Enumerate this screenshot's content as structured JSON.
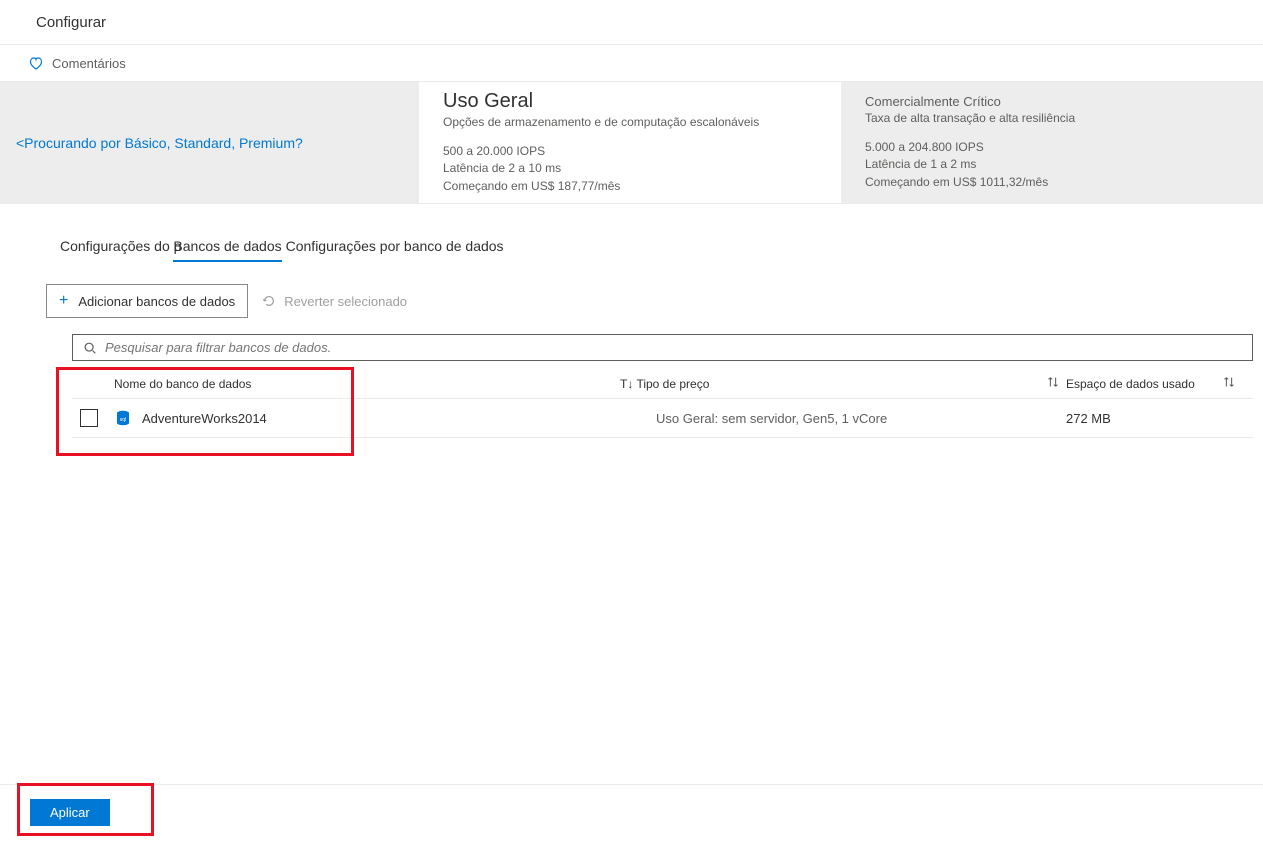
{
  "header": {
    "title": "Configurar"
  },
  "feedback": {
    "label": "Comentários"
  },
  "tiers": {
    "lookingForLink": "<Procurando por Básico, Standard, Premium?",
    "general": {
      "title": "Uso Geral",
      "subtitle": "Opções de armazenamento e de computação escalonáveis",
      "iops": "500 a 20.000 IOPS",
      "latency": "Latência de 2 a 10 ms",
      "price": "Começando em US$ 187,77/",
      "priceSuffix": "mês"
    },
    "critical": {
      "title": "Comercialmente Crítico",
      "subtitle": "Taxa de alta transação e alta resiliência",
      "iops": "5.000 a 204.800 IOPS",
      "latency": "Latência de 1 a 2 ms",
      "price": "Começando em US$ 1011,32/",
      "priceSuffix": "mês"
    }
  },
  "tabs": {
    "pool": "Configurações do p",
    "databases": "Bancos de dados",
    "perDatabase": "Configurações por banco de dados"
  },
  "toolbar": {
    "addLabel": "Adicionar bancos de dados",
    "revertLabel": "Reverter selecionado"
  },
  "search": {
    "placeholder": "Pesquisar para filtrar bancos de dados."
  },
  "table": {
    "columns": {
      "name": "Nome do banco de dados",
      "tier": "T↓ Tipo de preço",
      "space": "Espaço de dados usado"
    },
    "rows": [
      {
        "name": "AdventureWorks2014",
        "tier": "Uso Geral: sem servidor, Gen5, 1 vCore",
        "space": "272 MB"
      }
    ]
  },
  "footer": {
    "apply": "Aplicar"
  }
}
